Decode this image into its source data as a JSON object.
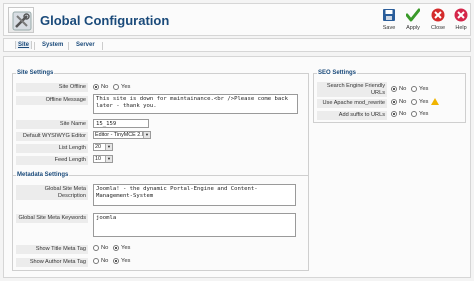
{
  "header": {
    "title": "Global Configuration",
    "icon": "config-toolbox-icon"
  },
  "toolbar": {
    "buttons": [
      {
        "label": "Save",
        "icon": "save-icon",
        "color": "#1a4a7a"
      },
      {
        "label": "Apply",
        "icon": "apply-icon",
        "color": "#3a9a2a"
      },
      {
        "label": "Close",
        "icon": "close-icon",
        "color": "#cc2222"
      },
      {
        "label": "Help",
        "icon": "help-icon",
        "color": "#cc2244"
      }
    ]
  },
  "tabs": [
    {
      "label": "Site",
      "active": true
    },
    {
      "label": "System",
      "active": false
    },
    {
      "label": "Server",
      "active": false
    }
  ],
  "site_settings": {
    "legend": "Site Settings",
    "site_offline_label": "Site Offline",
    "site_offline_no": "No",
    "site_offline_yes": "Yes",
    "site_offline_value": "No",
    "offline_message_label": "Offline Message",
    "offline_message_value": "This site is down for maintainance.<br />Please come back later - thank you.",
    "site_name_label": "Site Name",
    "site_name_value": "15_159",
    "wysiwyg_label": "Default WYSIWYG Editor",
    "wysiwyg_value": "Editor - TinyMCE 2.0",
    "list_length_label": "List Length",
    "list_length_value": "20",
    "feed_length_label": "Feed Length",
    "feed_length_value": "10"
  },
  "seo_settings": {
    "legend": "SEO Settings",
    "sef_label": "Search Engine Friendly URLs",
    "sef_value": "No",
    "rewrite_label": "Use Apache mod_rewrite",
    "rewrite_value": "No",
    "suffix_label": "Add suffix to URLs",
    "suffix_value": "No",
    "no": "No",
    "yes": "Yes"
  },
  "metadata_settings": {
    "legend": "Metadata Settings",
    "description_label": "Global Site Meta Description",
    "description_value": "Joomla! - the dynamic Portal-Engine and Content-Management-System",
    "keywords_label": "Global Site Meta Keywords",
    "keywords_value": "joomla",
    "show_title_label": "Show Title Meta Tag",
    "show_title_value": "Yes",
    "show_author_label": "Show Author Meta Tag",
    "show_author_value": "Yes",
    "no": "No",
    "yes": "Yes"
  }
}
